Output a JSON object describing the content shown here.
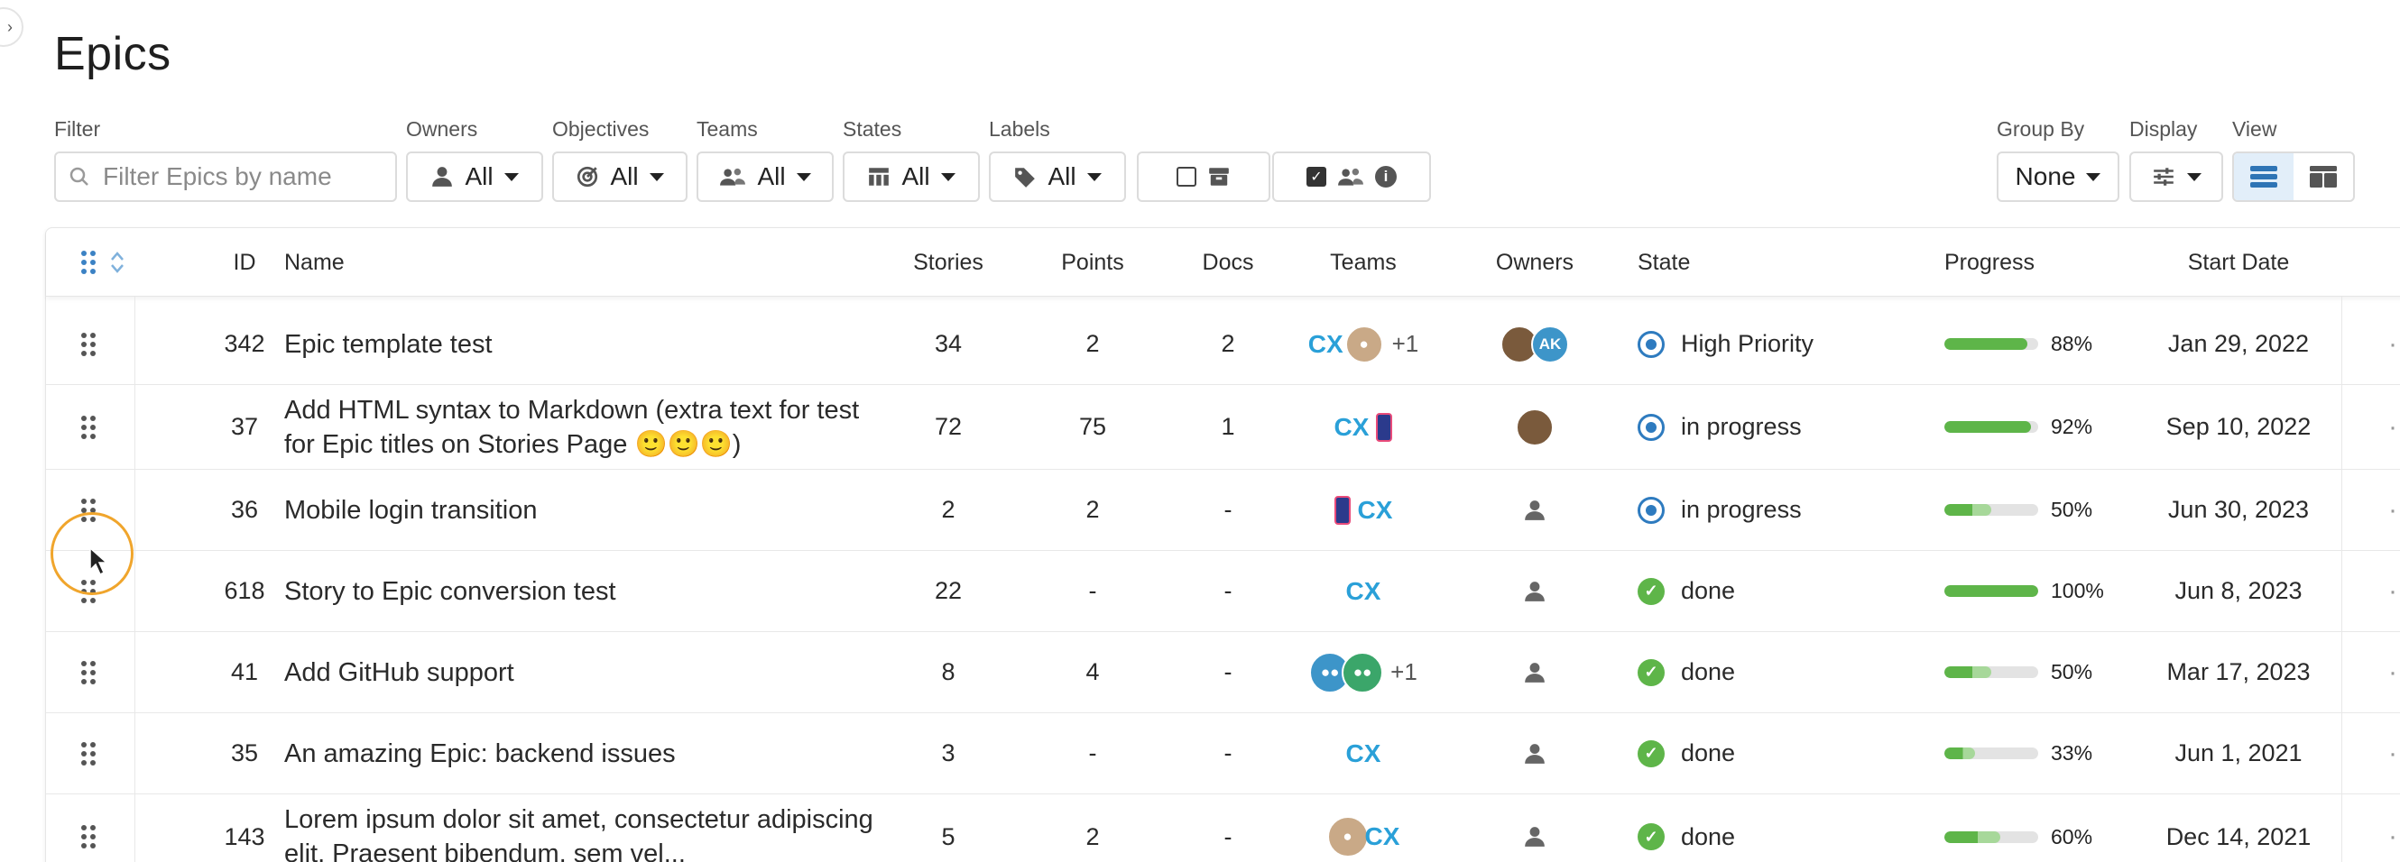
{
  "page": {
    "title": "Epics"
  },
  "filters": {
    "filter_label": "Filter",
    "search_placeholder": "Filter Epics by name",
    "owners": {
      "label": "Owners",
      "value": "All"
    },
    "objectives": {
      "label": "Objectives",
      "value": "All"
    },
    "teams": {
      "label": "Teams",
      "value": "All"
    },
    "states": {
      "label": "States",
      "value": "All"
    },
    "labels": {
      "label": "Labels",
      "value": "All"
    },
    "group_by": {
      "label": "Group By",
      "value": "None"
    },
    "display": {
      "label": "Display"
    },
    "view": {
      "label": "View"
    }
  },
  "columns": {
    "id": "ID",
    "name": "Name",
    "stories": "Stories",
    "points": "Points",
    "docs": "Docs",
    "teams": "Teams",
    "owners": "Owners",
    "state": "State",
    "progress": "Progress",
    "start_date": "Start Date"
  },
  "rows": [
    {
      "id": "342",
      "name": "Epic template test",
      "stories": "34",
      "points": "2",
      "docs": "2",
      "teams_extra": "+1",
      "owners_initials": "AK",
      "state": "High Priority",
      "progress": "88%",
      "start_date": "Jan 29, 2022"
    },
    {
      "id": "37",
      "name": "Add HTML syntax to Markdown (extra text for test for Epic titles on Stories Page 🙂🙂🙂)",
      "stories": "72",
      "points": "75",
      "docs": "1",
      "teams_extra": "",
      "owners_initials": "",
      "state": "in progress",
      "progress": "92%",
      "start_date": "Sep 10, 2022"
    },
    {
      "id": "36",
      "name": "Mobile login transition",
      "stories": "2",
      "points": "2",
      "docs": "-",
      "teams_extra": "",
      "owners_initials": "",
      "state": "in progress",
      "progress": "50%",
      "start_date": "Jun 30, 2023"
    },
    {
      "id": "618",
      "name": "Story to Epic conversion test",
      "stories": "22",
      "points": "-",
      "docs": "-",
      "teams_extra": "",
      "owners_initials": "",
      "state": "done",
      "progress": "100%",
      "start_date": "Jun 8, 2023"
    },
    {
      "id": "41",
      "name": "Add GitHub support",
      "stories": "8",
      "points": "4",
      "docs": "-",
      "teams_extra": "+1",
      "owners_initials": "",
      "state": "done",
      "progress": "50%",
      "start_date": "Mar 17, 2023"
    },
    {
      "id": "35",
      "name": "An amazing Epic: backend issues",
      "stories": "3",
      "points": "-",
      "docs": "-",
      "teams_extra": "",
      "owners_initials": "",
      "state": "done",
      "progress": "33%",
      "start_date": "Jun 1, 2021"
    },
    {
      "id": "143",
      "name": "Lorem ipsum dolor sit amet, consectetur adipiscing elit. Praesent bibendum, sem vel...",
      "stories": "5",
      "points": "2",
      "docs": "-",
      "teams_extra": "",
      "owners_initials": "",
      "state": "done",
      "progress": "60%",
      "start_date": "Dec 14, 2021"
    }
  ],
  "progress_values": [
    0.88,
    0.92,
    0.5,
    1.0,
    0.5,
    0.33,
    0.6
  ],
  "colors": {
    "accent": "#3b82c4",
    "done": "#5eb549",
    "in_progress": "#2e7bbf",
    "progress_fill": "#5eb549"
  },
  "icons": {
    "sidebar_toggle": "chevron-right-icon",
    "search": "search-icon",
    "owners": "user-icon",
    "objectives": "target-icon",
    "teams": "team-icon",
    "states": "columns-icon",
    "labels": "tag-icon",
    "archive": "archive-icon",
    "info": "info-icon",
    "row_handle": "drag-handle-icon",
    "more": "more-horizontal-icon"
  }
}
